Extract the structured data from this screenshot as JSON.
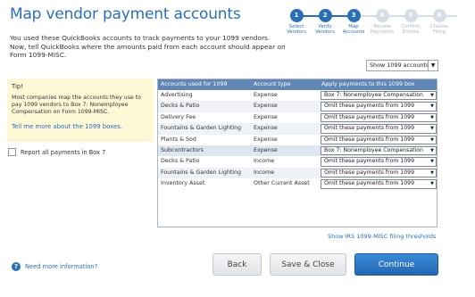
{
  "header": {
    "title": "Map vendor payment accounts",
    "intro": "You used these QuickBooks accounts to track payments to your 1099 vendors. Now, tell QuickBooks where the amounts paid from each account should appear on Form 1099-MISC."
  },
  "stepper": {
    "steps": [
      {
        "num": "1",
        "line1": "Select",
        "line2": "Vendors",
        "state": "done"
      },
      {
        "num": "2",
        "line1": "Verify",
        "line2": "Vendors",
        "state": "done"
      },
      {
        "num": "3",
        "line1": "Map",
        "line2": "Accounts",
        "state": "done"
      },
      {
        "num": "4",
        "line1": "Review",
        "line2": "Payments",
        "state": "todo"
      },
      {
        "num": "5",
        "line1": "Confirm",
        "line2": "Entries",
        "state": "todo"
      },
      {
        "num": "6",
        "line1": "Choose",
        "line2": "Filing",
        "state": "todo"
      }
    ]
  },
  "filter": {
    "show_value": "Show 1099 accounts"
  },
  "tip": {
    "heading": "Tip!",
    "body": "Most companies map the accounts they use to pay 1099 vendors to Box 7: Nonemployee Compensation on Form 1099-MISC.",
    "link": "Tell me more about the 1099 boxes."
  },
  "report_all_label": "Report all payments in Box 7",
  "table": {
    "columns": [
      "Accounts used for 1099",
      "Account type",
      "Apply payments to this 1099 box"
    ],
    "rows": [
      {
        "account": "Advertising",
        "type": "Expense",
        "box": "Box 7: Nonemployee Compensation"
      },
      {
        "account": "Decks & Patio",
        "type": "Expense",
        "box": "Omit these payments from 1099"
      },
      {
        "account": "Delivery Fee",
        "type": "Expense",
        "box": "Omit these payments from 1099"
      },
      {
        "account": "Fountains & Garden Lighting",
        "type": "Expense",
        "box": "Omit these payments from 1099"
      },
      {
        "account": "Plants & Sod",
        "type": "Expense",
        "box": "Omit these payments from 1099"
      },
      {
        "account": "Subcontractors",
        "type": "Expense",
        "box": "Box 7: Nonemployee Compensation"
      },
      {
        "account": "Decks & Patio",
        "type": "Income",
        "box": "Omit these payments from 1099"
      },
      {
        "account": "Fountains & Garden Lighting",
        "type": "Income",
        "box": "Omit these payments from 1099"
      },
      {
        "account": "Inventory Asset",
        "type": "Other Current Asset",
        "box": "Omit these payments from 1099"
      }
    ]
  },
  "thresholds_link": "Show IRS 1099-MISC filing thresholds",
  "footer": {
    "help": "Need more information?",
    "back": "Back",
    "save_close": "Save & Close",
    "continue": "Continue"
  },
  "colors": {
    "accent": "#2a6fb5",
    "header_bg": "#5f86b5",
    "tip_bg": "#fff8d7",
    "continue_bg": "#2367b2"
  },
  "icons": {
    "help": "info-circle-icon",
    "dropdown": "caret-down-icon"
  }
}
